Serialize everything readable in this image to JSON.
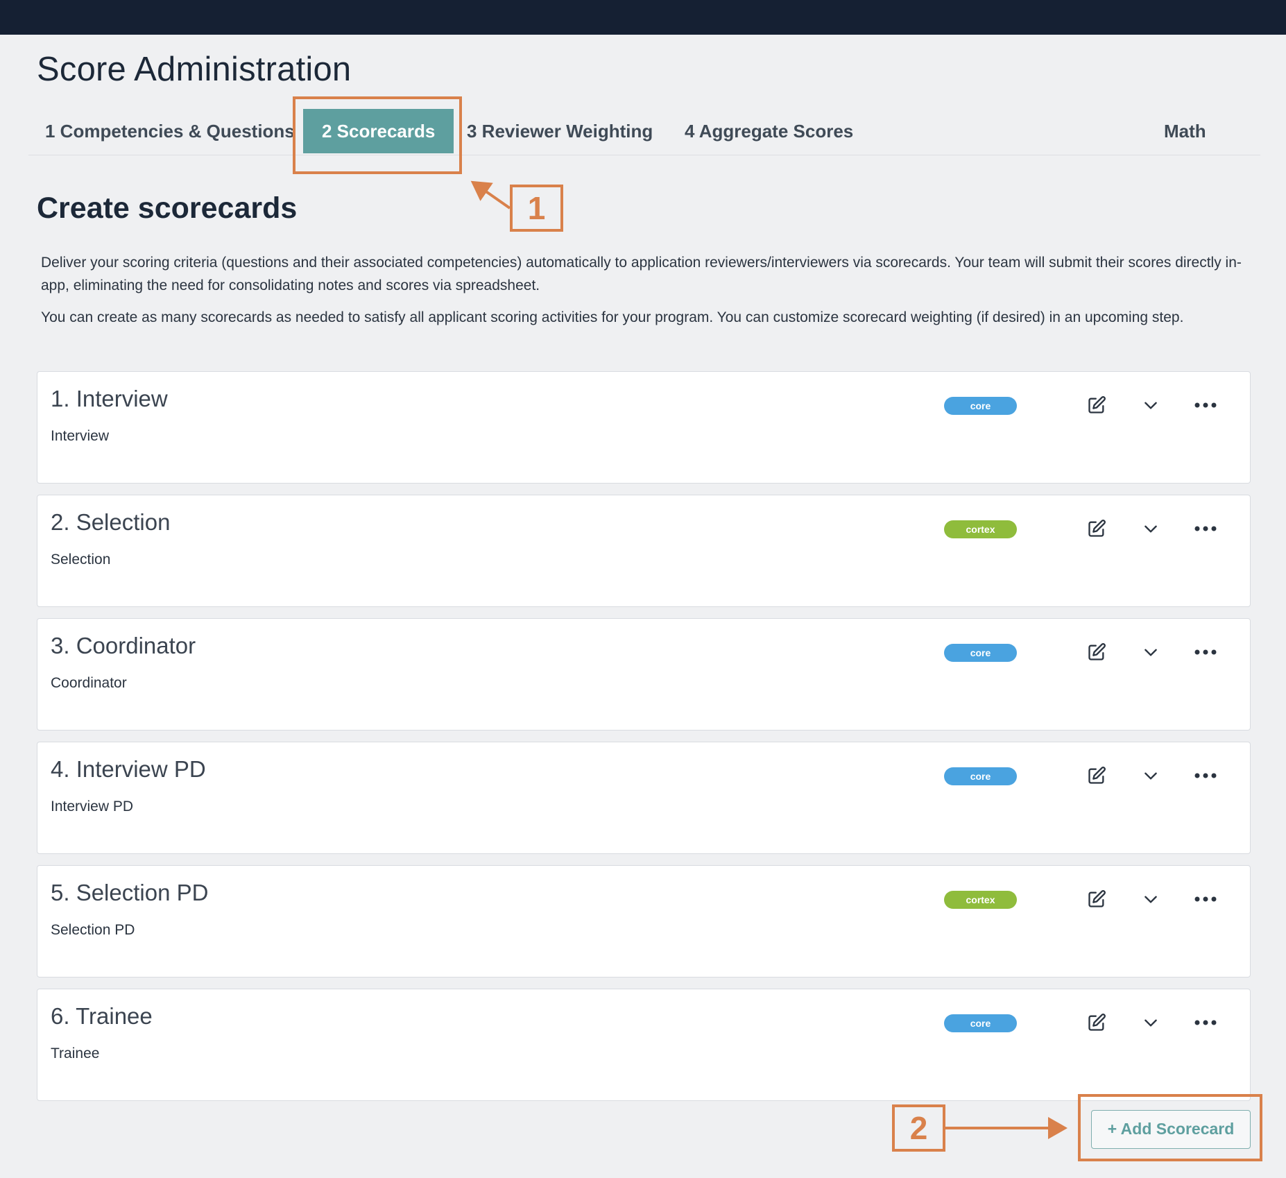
{
  "page": {
    "title": "Score Administration"
  },
  "tabs": [
    {
      "label": "1 Competencies & Questions"
    },
    {
      "label": "2 Scorecards"
    },
    {
      "label": "3 Reviewer Weighting"
    },
    {
      "label": "4 Aggregate Scores"
    },
    {
      "label": "Math"
    }
  ],
  "active_tab": "2 Scorecards",
  "section": {
    "title": "Create scorecards",
    "description_1": "Deliver your scoring criteria (questions and their associated competencies) automatically to application reviewers/interviewers via scorecards. Your team will submit their scores directly in-app, eliminating the need for consolidating notes and scores via spreadsheet.",
    "description_2": "You can create as many scorecards as needed to satisfy all applicant scoring activities for your program. You can customize scorecard weighting (if desired) in an upcoming step."
  },
  "scorecards": [
    {
      "title": "1. Interview",
      "subtitle": "Interview",
      "badge": "core"
    },
    {
      "title": "2. Selection",
      "subtitle": "Selection",
      "badge": "cortex"
    },
    {
      "title": "3. Coordinator",
      "subtitle": "Coordinator",
      "badge": "core"
    },
    {
      "title": "4. Interview PD",
      "subtitle": "Interview PD",
      "badge": "core"
    },
    {
      "title": "5. Selection PD",
      "subtitle": "Selection PD",
      "badge": "cortex"
    },
    {
      "title": "6. Trainee",
      "subtitle": "Trainee",
      "badge": "core"
    }
  ],
  "add_button": {
    "label": "+ Add Scorecard"
  },
  "annotations": [
    {
      "number": "1"
    },
    {
      "number": "2"
    }
  ],
  "colors": {
    "topbar": "#152033",
    "accent_teal": "#5e9f9f",
    "badge_core": "#4aa3e0",
    "badge_cortex": "#8fbc3c",
    "annotation": "#d9814b"
  },
  "icons": {
    "edit": "edit-icon",
    "chevron": "chevron-down-icon",
    "more": "more-horizontal-icon"
  }
}
